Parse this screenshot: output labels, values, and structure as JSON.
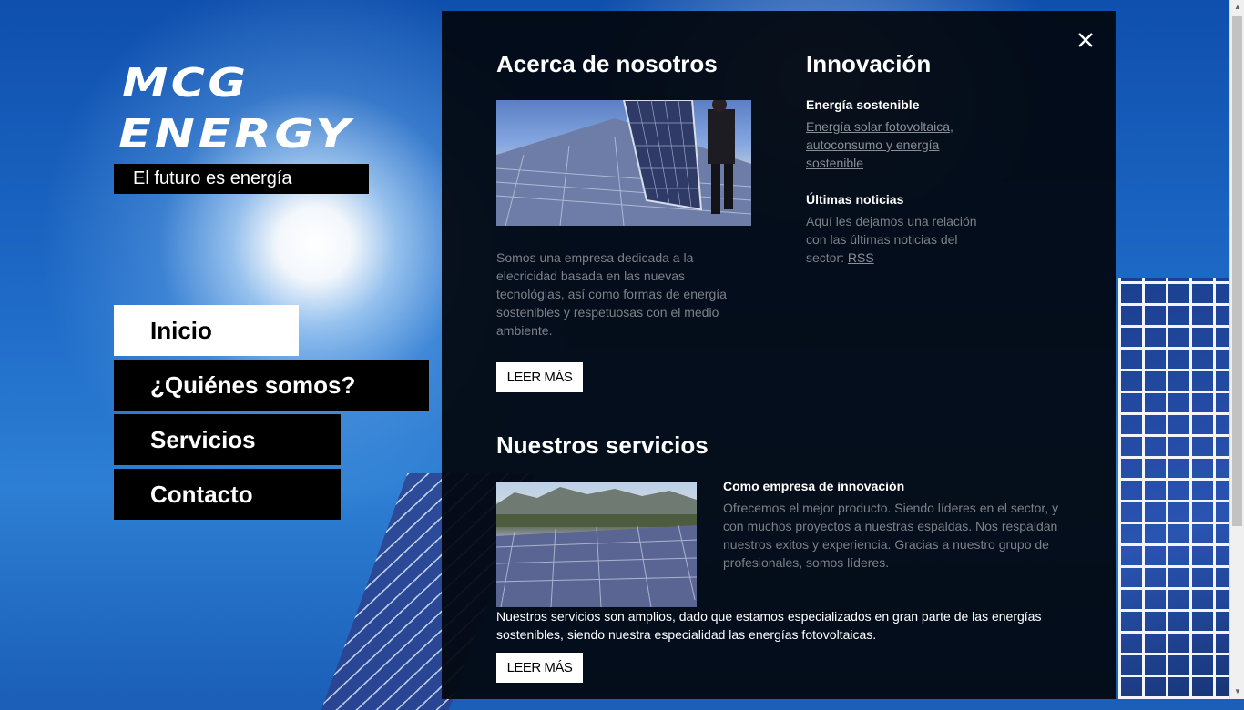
{
  "brand": {
    "logo_line1": "MCG",
    "logo_line2": "ENERGY",
    "tagline": "El futuro es energía"
  },
  "nav": {
    "items": [
      {
        "label": "Inicio",
        "active": true
      },
      {
        "label": "¿Quiénes somos?",
        "active": false
      },
      {
        "label": "Servicios",
        "active": false
      },
      {
        "label": "Contacto",
        "active": false
      }
    ]
  },
  "about": {
    "heading": "Acerca de nosotros",
    "text": "Somos una empresa dedicada a la elecricidad basada en las nuevas tecnológias, así como formas de energía sostenibles y respetuosas con el medio ambiente.",
    "button": "LEER MÁS"
  },
  "innovation": {
    "heading": "Innovación",
    "sustainable_title": "Energía sostenible",
    "sustainable_link": "Energía solar fotovoltaica, autoconsumo y energía sostenible",
    "news_title": "Últimas noticias",
    "news_text": "Aquí les dejamos una relación con las últimas noticias del sector: ",
    "news_link": "RSS"
  },
  "services": {
    "heading": "Nuestros servicios",
    "sub_title": "Como empresa de innovación",
    "sub_text": "Ofrecemos el mejor producto. Siendo líderes en el sector, y con muchos proyectos a nuestras espaldas. Nos respaldan nuestros exitos y experiencia. Gracias a nuestro grupo de profesionales, somos líderes.",
    "text": "Nuestros servicios son amplios, dado que estamos especializados en gran parte de las energías sostenibles, siendo nuestra especialidad las energías fotovoltaicas.",
    "button": "LEER MÁS"
  },
  "colors": {
    "panel": "#02060e",
    "sky": "#1b5fb8",
    "muted_text": "#7d8087"
  }
}
